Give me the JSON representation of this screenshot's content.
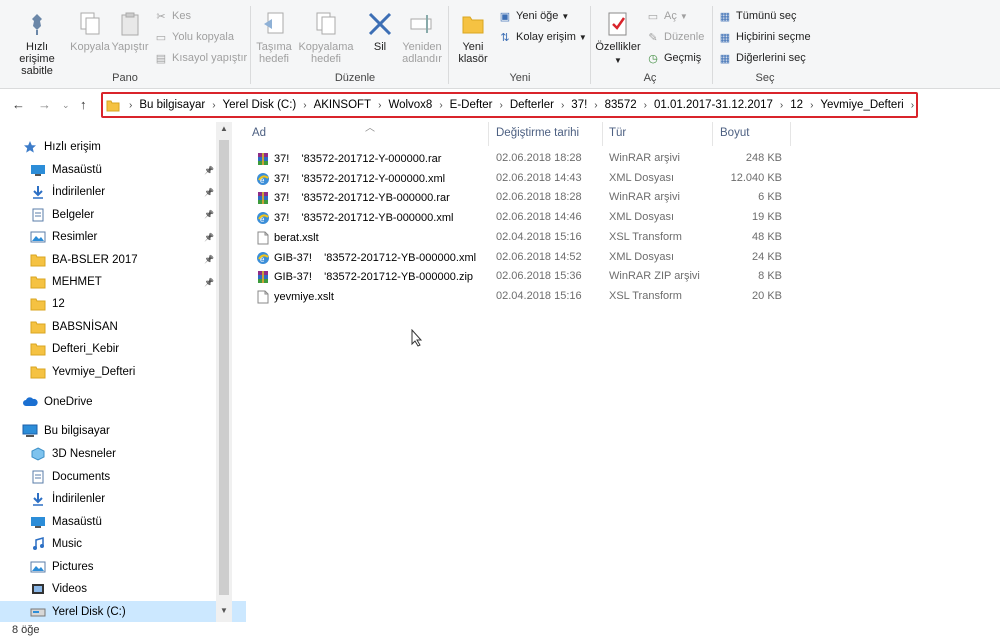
{
  "ribbon": {
    "pano": {
      "group": "Pano",
      "pin": "Hızlı erişime sabitle",
      "copy": "Kopyala",
      "paste": "Yapıştır",
      "cut": "Kes",
      "copy_path": "Yolu kopyala",
      "paste_shortcut": "Kısayol yapıştır"
    },
    "duzenle": {
      "group": "Düzenle",
      "move_to": "Taşıma hedefi",
      "copy_to": "Kopyalama hedefi",
      "delete": "Sil",
      "rename": "Yeniden adlandır"
    },
    "yeni": {
      "group": "Yeni",
      "new_folder": "Yeni klasör",
      "new_item": "Yeni öğe",
      "easy_access": "Kolay erişim"
    },
    "ac": {
      "group": "Aç",
      "properties": "Özellikler",
      "open": "Aç",
      "edit": "Düzenle",
      "history": "Geçmiş"
    },
    "sec": {
      "group": "Seç",
      "select_all": "Tümünü seç",
      "select_none": "Hiçbirini seçme",
      "invert": "Diğerlerini seç"
    }
  },
  "address": {
    "crumbs": [
      "Bu bilgisayar",
      "Yerel Disk (C:)",
      "AKINSOFT",
      "Wolvox8",
      "E-Defter",
      "Defterler",
      "37!",
      "83572",
      "01.01.2017-31.12.2017",
      "12",
      "Yevmiye_Defteri"
    ]
  },
  "nav": {
    "quick_access": "Hızlı erişim",
    "quick_items": [
      "Masaüstü",
      "İndirilenler",
      "Belgeler",
      "Resimler",
      "BA-BSLER 2017",
      "MEHMET",
      "12",
      "BABSNİSAN",
      "Defteri_Kebir",
      "Yevmiye_Defteri"
    ],
    "onedrive": "OneDrive",
    "this_pc": "Bu bilgisayar",
    "pc_items": [
      "3D Nesneler",
      "Documents",
      "İndirilenler",
      "Masaüstü",
      "Music",
      "Pictures",
      "Videos",
      "Yerel Disk (C:)"
    ]
  },
  "columns": {
    "name": "Ad",
    "date": "Değiştirme tarihi",
    "type": "Tür",
    "size": "Boyut"
  },
  "files": [
    {
      "name": "37!    '83572-201712-Y-000000.rar",
      "date": "02.06.2018 18:28",
      "type": "WinRAR arşivi",
      "size": "248 KB",
      "icon": "rar"
    },
    {
      "name": "37!    '83572-201712-Y-000000.xml",
      "date": "02.06.2018 14:43",
      "type": "XML Dosyası",
      "size": "12.040 KB",
      "icon": "xml"
    },
    {
      "name": "37!    '83572-201712-YB-000000.rar",
      "date": "02.06.2018 18:28",
      "type": "WinRAR arşivi",
      "size": "6 KB",
      "icon": "rar"
    },
    {
      "name": "37!    '83572-201712-YB-000000.xml",
      "date": "02.06.2018 14:46",
      "type": "XML Dosyası",
      "size": "19 KB",
      "icon": "xml"
    },
    {
      "name": "berat.xslt",
      "date": "02.04.2018 15:16",
      "type": "XSL Transform",
      "size": "48 KB",
      "icon": "doc"
    },
    {
      "name": "GIB-37!    '83572-201712-YB-000000.xml",
      "date": "02.06.2018 14:52",
      "type": "XML Dosyası",
      "size": "24 KB",
      "icon": "xml"
    },
    {
      "name": "GIB-37!    '83572-201712-YB-000000.zip",
      "date": "02.06.2018 15:36",
      "type": "WinRAR ZIP arşivi",
      "size": "8 KB",
      "icon": "rar"
    },
    {
      "name": "yevmiye.xslt",
      "date": "02.04.2018 15:16",
      "type": "XSL Transform",
      "size": "20 KB",
      "icon": "doc"
    }
  ],
  "status": {
    "count": "8 öğe"
  }
}
